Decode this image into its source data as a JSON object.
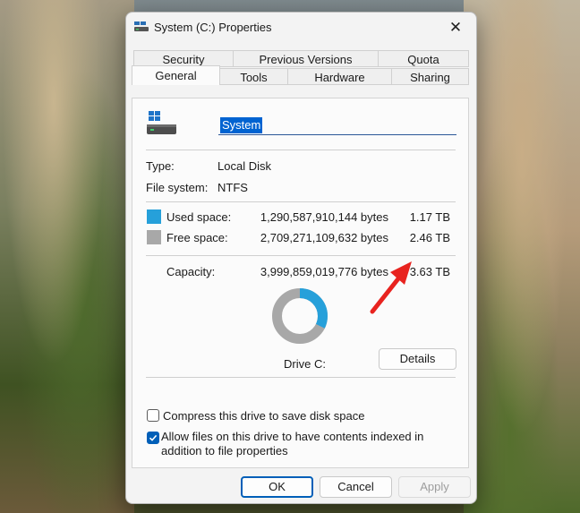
{
  "window": {
    "title": "System (C:) Properties",
    "close_glyph": "✕"
  },
  "tabs": {
    "row_back": [
      "Security",
      "Previous Versions",
      "Quota"
    ],
    "row_front": [
      "General",
      "Tools",
      "Hardware",
      "Sharing"
    ],
    "active": "General"
  },
  "general": {
    "drive_name": "System",
    "type_label": "Type:",
    "type_value": "Local Disk",
    "fs_label": "File system:",
    "fs_value": "NTFS",
    "used_label": "Used space:",
    "used_bytes": "1,290,587,910,144 bytes",
    "used_size": "1.17 TB",
    "free_label": "Free space:",
    "free_bytes": "2,709,271,109,632 bytes",
    "free_size": "2.46 TB",
    "capacity_label": "Capacity:",
    "capacity_bytes": "3,999,859,019,776 bytes",
    "capacity_size": "3.63 TB",
    "used_fraction": 0.323,
    "drive_caption": "Drive C:",
    "details_button": "Details",
    "compress_label": "Compress this drive to save disk space",
    "compress_checked": false,
    "index_label": "Allow files on this drive to have contents indexed in addition to file properties",
    "index_checked": true
  },
  "colors": {
    "used": "#26a0da",
    "free": "#a8a8a8",
    "accent": "#005fb8",
    "annotation_arrow": "#e8231f"
  },
  "buttons": {
    "ok": "OK",
    "cancel": "Cancel",
    "apply": "Apply"
  }
}
